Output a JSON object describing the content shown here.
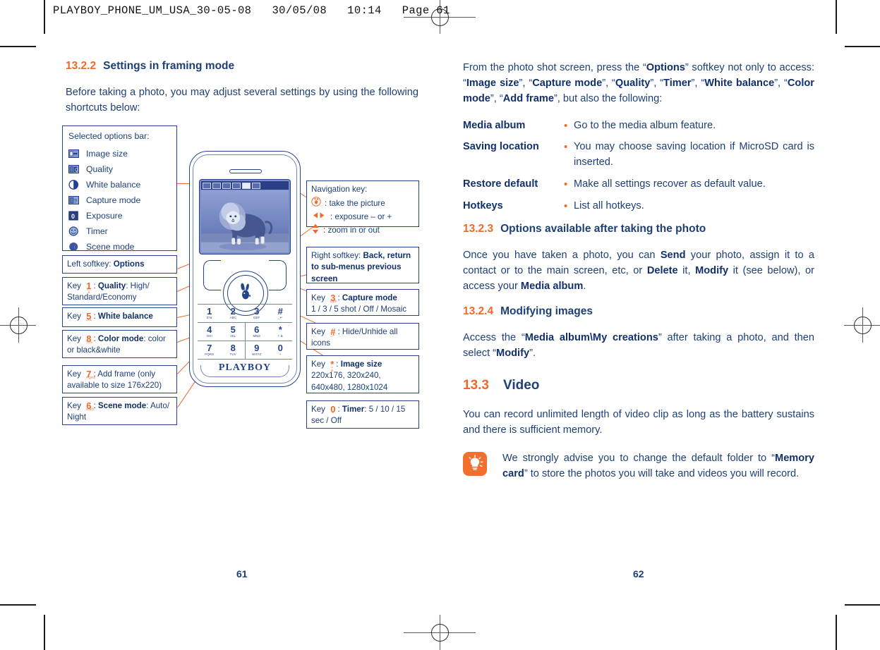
{
  "slug": "PLAYBOY_PHONE_UM_USA_30-05-08   30/05/08   10:14   Page 61",
  "colors": {
    "accent_orange": "#ef6a2a",
    "heading_blue": "#1d3f78",
    "body_blue": "#1d3f78",
    "box_border": "#23448a",
    "tip_icon_bg": "#f26f2d"
  },
  "left_column": {
    "section": {
      "number": "13.2.2",
      "title": "Settings in framing mode"
    },
    "intro": "Before taking a photo, you may adjust several settings by using the following shortcuts below:"
  },
  "figure": {
    "options_box": {
      "title": "Selected options bar:",
      "items": [
        {
          "icon": "image-size-icon",
          "label": "Image size"
        },
        {
          "icon": "quality-icon",
          "label": "Quality"
        },
        {
          "icon": "white-balance-icon",
          "label": "White balance"
        },
        {
          "icon": "capture-mode-icon",
          "label": "Capture mode"
        },
        {
          "icon": "exposure-icon",
          "label": "Exposure"
        },
        {
          "icon": "timer-icon",
          "label": "Timer"
        },
        {
          "icon": "scene-mode-icon",
          "label": "Scene mode"
        }
      ]
    },
    "left_callouts": [
      {
        "lead": "Left softkey: ",
        "strong": "Options",
        "tail": ""
      },
      {
        "lead": "Key ",
        "key": "1",
        "keysub": "0?ø",
        "strong": "Quality",
        "tail": ": High/ Standard/Economy",
        "sep": ": "
      },
      {
        "lead": "Key ",
        "key": "5",
        "keysub": "JKL",
        "strong": "White balance",
        "tail": "",
        "sep": ": "
      },
      {
        "lead": "Key ",
        "key": "8",
        "keysub": "TUV",
        "strong": "Color mode",
        "tail": ": color or black&white",
        "sep": ": "
      },
      {
        "lead": "Key ",
        "key": "7",
        "keysub": "PQRS",
        "strong": "",
        "tail": ": Add frame (only available to size 176x220)",
        "sep": ""
      },
      {
        "lead": "Key ",
        "key": "6",
        "keysub": "MNO",
        "strong": "Scene mode",
        "tail": ": Auto/ Night",
        "sep": ": "
      }
    ],
    "right_callouts": {
      "navigation": {
        "title": "Navigation key:",
        "lines": [
          {
            "glyph": "bunny-ok-icon",
            "text": ": take the picture"
          },
          {
            "glyph": "left-right-arrows-icon",
            "text": ": exposure – or +"
          },
          {
            "glyph": "up-down-arrows-icon",
            "text": ": zoom in or out"
          }
        ]
      },
      "right_softkey": {
        "lead": "Right softkey: ",
        "strong": "Back, return to sub-menus previous screen"
      },
      "key3": {
        "lead": "Key ",
        "key": "3",
        "keysub": "DEF",
        "strong": "Capture mode",
        "tail": "1 / 3 / 5 shot / Off / Mosaic",
        "sep": ": "
      },
      "keyhash": {
        "lead": "Key ",
        "key": "#",
        "keysub": "_↵",
        "strong": "",
        "tail": ": Hide/Unhide all icons",
        "sep": ""
      },
      "keystar": {
        "lead": "Key ",
        "key": "*",
        "keysub": "+ &",
        "strong": "Image size",
        "tail": "220x176, 320x240, 640x480, 1280x1024",
        "sep": ": "
      },
      "key0": {
        "lead": "Key ",
        "key": "0",
        "keysub": "+",
        "strong": "Timer",
        "tail": ": 5 / 10 / 15 sec / Off",
        "sep": ": "
      }
    },
    "phone": {
      "brand": "PLAYBOY",
      "screen_image": "lion-photo",
      "status_icons": [
        "flash-icon",
        "image-size-icon",
        "scene-mode-icon",
        "quality-icon",
        "white-balance-icon",
        "capture-mode-icon"
      ],
      "keys": [
        {
          "num": "1",
          "sub": "0?ø"
        },
        {
          "num": "2",
          "sub": "ABC"
        },
        {
          "num": "3",
          "sub": "DEF"
        },
        {
          "num": "#",
          "sub": "_↵"
        },
        {
          "num": "4",
          "sub": "GHI"
        },
        {
          "num": "5",
          "sub": "JKL"
        },
        {
          "num": "6",
          "sub": "MNO"
        },
        {
          "num": "*",
          "sub": "+ &"
        },
        {
          "num": "7",
          "sub": "PQRS"
        },
        {
          "num": "8",
          "sub": "TUV"
        },
        {
          "num": "9",
          "sub": "WXYZ"
        },
        {
          "num": "0",
          "sub": "+"
        }
      ]
    }
  },
  "right_column": {
    "intro_paragraph": {
      "p1": "From the photo shot screen, press the “",
      "b1": "Options",
      "p2": "” softkey not only to access: “",
      "b2": "Image size",
      "p3": "”, “",
      "b3": "Capture mode",
      "p4": "”, “",
      "b4": "Quality",
      "p5": "”, “",
      "b5": "Timer",
      "p6": "”, “",
      "b6": "White balance",
      "p7": "”, “",
      "b7": "Color mode",
      "p8": "”, “",
      "b8": "Add frame",
      "p9": "”, but also the following:"
    },
    "definitions": [
      {
        "term": "Media album",
        "bullet": "•",
        "desc": "Go to the media album feature."
      },
      {
        "term": "Saving location",
        "bullet": "•",
        "desc": "You may choose saving location if MicroSD card is inserted."
      },
      {
        "term": "Restore default",
        "bullet": "•",
        "desc": "Make all settings recover as default value."
      },
      {
        "term": "Hotkeys",
        "bullet": "•",
        "desc": "List all hotkeys."
      }
    ],
    "section_1323": {
      "number": "13.2.3",
      "title": "Options available after taking the photo"
    },
    "para_1323": {
      "p1": "Once you have taken a photo, you can ",
      "b1": "Send",
      "p2": " your photo, assign it to a contact or to the main screen, etc, or ",
      "b2": "Delete",
      "p3": " it, ",
      "b3": "Modify",
      "p4": " it (see below), or access your ",
      "b4": "Media album",
      "p5": "."
    },
    "section_1324": {
      "number": "13.2.4",
      "title": "Modifying images"
    },
    "para_1324": {
      "p1": "Access the “",
      "b1": "Media album\\My creations",
      "p2": "” after taking a photo, and then select “",
      "b2": "Modify",
      "p3": "”."
    },
    "section_133": {
      "number": "13.3",
      "title": "Video"
    },
    "para_133": "You can record unlimited length of video clip as long as the battery sustains and there is sufficient memory.",
    "tip": {
      "icon": "lightbulb-tip-icon",
      "p1": "We strongly advise you to change the default folder to “",
      "b1": "Memory card",
      "p2": "” to store the photos you will take and videos you will record."
    }
  },
  "page_numbers": {
    "left": "61",
    "right": "62"
  }
}
